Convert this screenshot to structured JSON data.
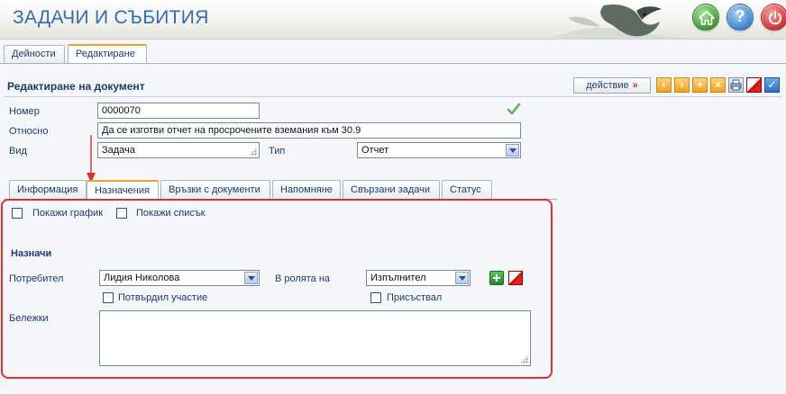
{
  "header": {
    "title": "ЗАДАЧИ И СЪБИТИЯ",
    "home_icon": "home-icon",
    "help_icon": "help-icon",
    "help_glyph": "?",
    "power_icon": "power-icon"
  },
  "top_tabs": [
    {
      "label": "Дейности",
      "active": false
    },
    {
      "label": "Редактиране",
      "active": true
    }
  ],
  "section": {
    "title": "Редактиране на документ",
    "action_label": "действие",
    "action_arrow": "»"
  },
  "toolbar": {
    "prev": "‹",
    "next": "›",
    "add": "+",
    "remove": "×",
    "print_icon": "print-icon",
    "cancel_icon": "cancel-icon",
    "confirm": "✓"
  },
  "form": {
    "number_label": "Номер",
    "number_value": "0000070",
    "subject_label": "Относно",
    "subject_value": "Да се изготви отчет на просрочените вземания към 30.9",
    "kind_label": "Вид",
    "kind_value": "Задача",
    "type_label": "Тип",
    "type_value": "Отчет"
  },
  "sub_tabs": [
    {
      "label": "Информация",
      "active": false
    },
    {
      "label": "Назначения",
      "active": true
    },
    {
      "label": "Връзки с документи",
      "active": false
    },
    {
      "label": "Напомняне",
      "active": false
    },
    {
      "label": "Свързани задачи",
      "active": false
    },
    {
      "label": "Статус",
      "active": false
    }
  ],
  "assignments": {
    "show_schedule_label": "Покажи график",
    "show_list_label": "Покажи списък",
    "heading": "Назначи",
    "user_label": "Потребител",
    "user_value": "Лидия Николова",
    "role_label": "В ролята на",
    "role_value": "Изпълнител",
    "confirmed_label": "Потвърдил участие",
    "present_label": "Присъствал",
    "notes_label": "Бележки",
    "notes_value": ""
  },
  "colors": {
    "accent": "#2f6db7",
    "highlight_frame": "#e03030",
    "active_tab_top": "#f0a030"
  }
}
